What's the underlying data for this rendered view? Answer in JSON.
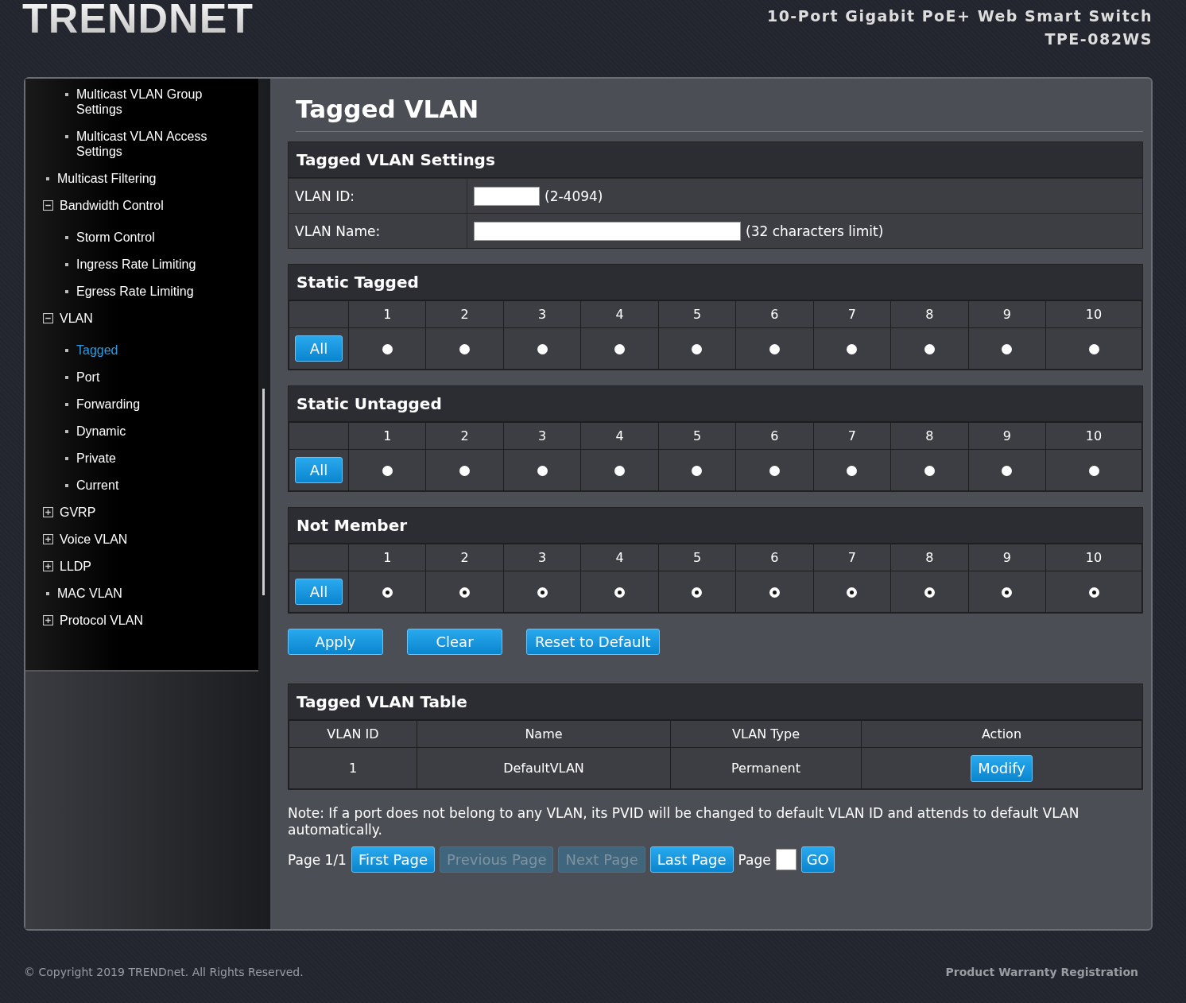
{
  "header": {
    "logo": "TRENDNET",
    "product": "10-Port Gigabit PoE+ Web Smart Switch",
    "model": "TPE-082WS"
  },
  "sidebar": {
    "items": [
      {
        "kind": "group",
        "children": [
          {
            "kind": "page",
            "label": "Multicast VLAN Group Settings",
            "selected": false
          },
          {
            "kind": "page",
            "label": "Multicast VLAN Access Settings",
            "selected": false
          }
        ]
      },
      {
        "kind": "page",
        "label": "Multicast Filtering",
        "selected": false
      },
      {
        "kind": "folder",
        "label": "Bandwidth Control",
        "expanded": true,
        "children": [
          {
            "kind": "page",
            "label": "Storm Control",
            "selected": false
          },
          {
            "kind": "page",
            "label": "Ingress Rate Limiting",
            "selected": false
          },
          {
            "kind": "page",
            "label": "Egress Rate Limiting",
            "selected": false
          }
        ]
      },
      {
        "kind": "folder",
        "label": "VLAN",
        "expanded": true,
        "children": [
          {
            "kind": "page",
            "label": "Tagged",
            "selected": true
          },
          {
            "kind": "page",
            "label": "Port",
            "selected": false
          },
          {
            "kind": "page",
            "label": "Forwarding",
            "selected": false
          },
          {
            "kind": "page",
            "label": "Dynamic",
            "selected": false
          },
          {
            "kind": "page",
            "label": "Private",
            "selected": false
          },
          {
            "kind": "page",
            "label": "Current",
            "selected": false
          }
        ]
      },
      {
        "kind": "folder",
        "label": "GVRP",
        "expanded": false
      },
      {
        "kind": "folder",
        "label": "Voice VLAN",
        "expanded": false
      },
      {
        "kind": "folder",
        "label": "LLDP",
        "expanded": false
      },
      {
        "kind": "page",
        "label": "MAC VLAN",
        "selected": false
      },
      {
        "kind": "folder",
        "label": "Protocol VLAN",
        "expanded": false
      }
    ]
  },
  "page_title": "Tagged VLAN",
  "settings": {
    "title": "Tagged VLAN Settings",
    "fields": [
      {
        "label": "VLAN ID:",
        "hint": "(2-4094)",
        "kind": "narrow"
      },
      {
        "label": "VLAN Name:",
        "hint": "(32 characters limit)",
        "kind": "wide"
      }
    ]
  },
  "port_groups": [
    {
      "title": "Static Tagged",
      "button": "All",
      "ports": [
        {
          "label": "1",
          "selected": false
        },
        {
          "label": "2",
          "selected": false
        },
        {
          "label": "3",
          "selected": false
        },
        {
          "label": "4",
          "selected": false
        },
        {
          "label": "5",
          "selected": false
        },
        {
          "label": "6",
          "selected": false
        },
        {
          "label": "7",
          "selected": false
        },
        {
          "label": "8",
          "selected": false
        },
        {
          "label": "9",
          "selected": false
        },
        {
          "label": "10",
          "selected": false
        }
      ]
    },
    {
      "title": "Static Untagged",
      "button": "All",
      "ports": [
        {
          "label": "1",
          "selected": false
        },
        {
          "label": "2",
          "selected": false
        },
        {
          "label": "3",
          "selected": false
        },
        {
          "label": "4",
          "selected": false
        },
        {
          "label": "5",
          "selected": false
        },
        {
          "label": "6",
          "selected": false
        },
        {
          "label": "7",
          "selected": false
        },
        {
          "label": "8",
          "selected": false
        },
        {
          "label": "9",
          "selected": false
        },
        {
          "label": "10",
          "selected": false
        }
      ]
    },
    {
      "title": "Not Member",
      "button": "All",
      "ports": [
        {
          "label": "1",
          "selected": true
        },
        {
          "label": "2",
          "selected": true
        },
        {
          "label": "3",
          "selected": true
        },
        {
          "label": "4",
          "selected": true
        },
        {
          "label": "5",
          "selected": true
        },
        {
          "label": "6",
          "selected": true
        },
        {
          "label": "7",
          "selected": true
        },
        {
          "label": "8",
          "selected": true
        },
        {
          "label": "9",
          "selected": true
        },
        {
          "label": "10",
          "selected": true
        }
      ]
    }
  ],
  "actions": [
    "Apply",
    "Clear",
    "Reset to Default"
  ],
  "table": {
    "title": "Tagged VLAN Table",
    "columns": [
      "VLAN ID",
      "Name",
      "VLAN Type",
      "Action"
    ],
    "rows": [
      {
        "cells": [
          "1",
          "DefaultVLAN",
          "Permanent"
        ],
        "action": "Modify"
      }
    ]
  },
  "note": "Note: If a port does not belong to any VLAN, its PVID will be changed to default VLAN ID and attends to default VLAN automatically.",
  "pagination": {
    "status": "Page 1/1",
    "buttons": [
      {
        "label": "First Page",
        "disabled": false
      },
      {
        "label": "Previous Page",
        "disabled": true
      },
      {
        "label": "Next Page",
        "disabled": true
      },
      {
        "label": "Last Page",
        "disabled": false
      }
    ],
    "page_label": "Page",
    "go": "GO"
  },
  "footer": {
    "copyright": "© Copyright 2019 TRENDnet. All Rights Reserved.",
    "link": "Product Warranty Registration"
  }
}
